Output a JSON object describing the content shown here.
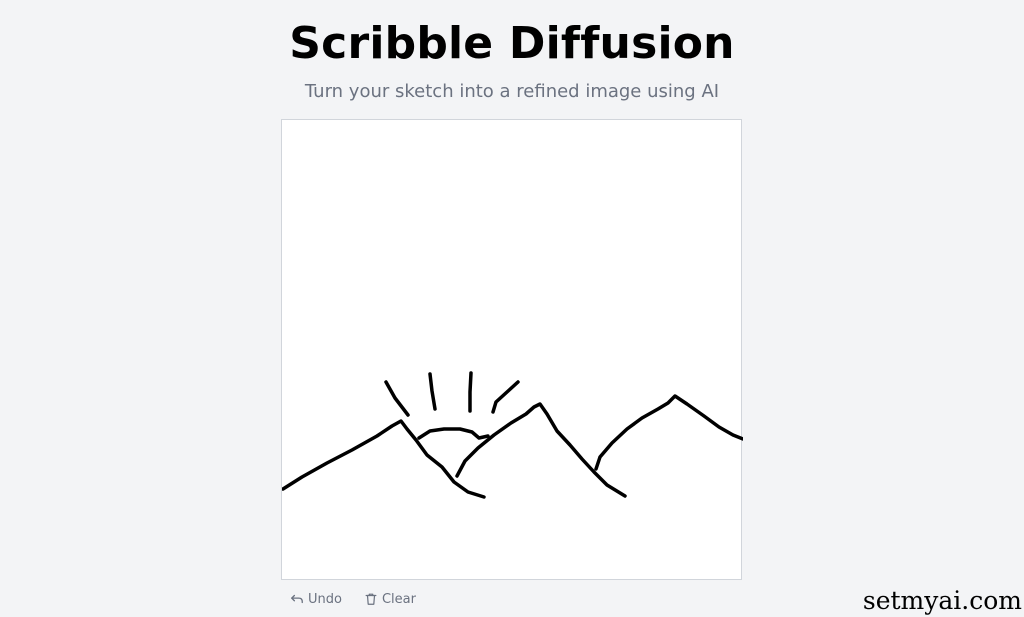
{
  "header": {
    "title": "Scribble Diffusion",
    "subtitle": "Turn your sketch into a refined image using AI"
  },
  "canvas": {
    "background": "#ffffff",
    "stroke_color": "#000000"
  },
  "toolbar": {
    "undo_label": "Undo",
    "undo_icon": "undo-arrow-icon",
    "clear_label": "Clear",
    "clear_icon": "trash-icon"
  },
  "watermark": {
    "text": "setmyai.com"
  },
  "colors": {
    "page_background": "#f3f4f6",
    "muted_text": "#6b7280"
  }
}
